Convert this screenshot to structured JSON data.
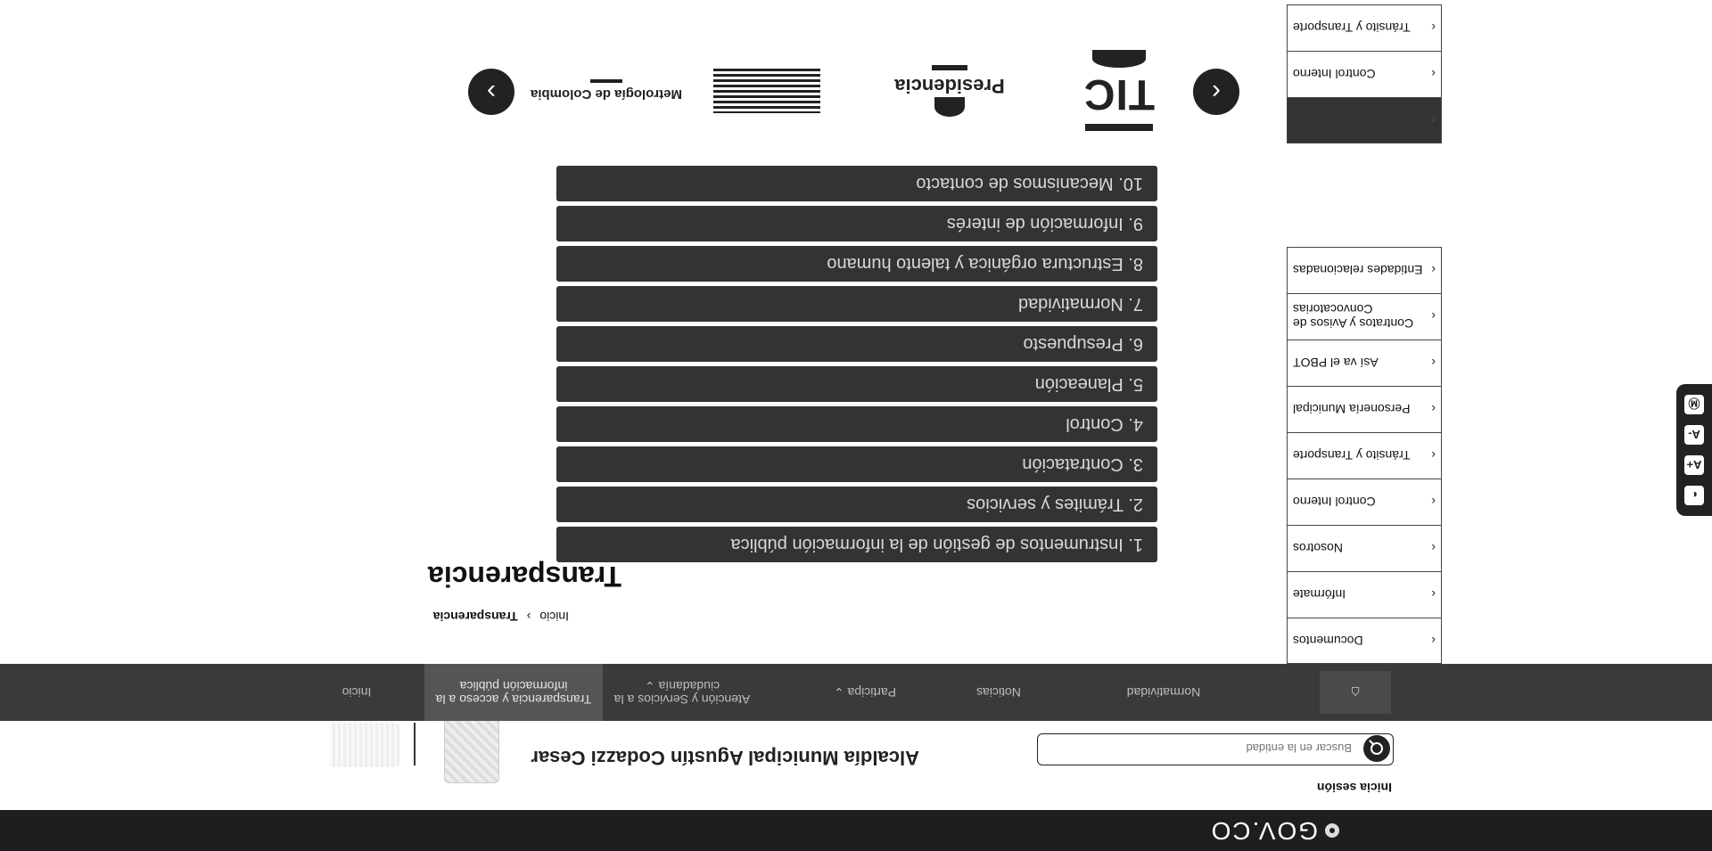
{
  "topbar": {
    "brand": "GOV.CO"
  },
  "header": {
    "login_label": "Inicia sesión",
    "search_placeholder": "Buscar en la entidad",
    "entity_name": "Alcaldía Municipal Agustín Codazzi Cesar"
  },
  "nav": {
    "items": [
      {
        "label": "Normatividad"
      },
      {
        "label": "Noticias"
      },
      {
        "label": "Participa ⌄"
      },
      {
        "label": "Atención y Servicios a la ciudadanía ⌄"
      },
      {
        "label": "Transparencia y acceso a la información pública"
      },
      {
        "label": "Inicio"
      }
    ]
  },
  "breadcrumb": {
    "home": "Inicio",
    "sep": "›",
    "current": "Transparencia"
  },
  "page": {
    "title": "Transparencia"
  },
  "accordion": [
    "1. Instrumentos de gestión de la información pública",
    "2. Trámites y servicios",
    "3. Contratación",
    "4. Control",
    "5. Planeación",
    "6. Presupuesto",
    "7. Normatividad",
    "8. Estructura orgánica y talento humano",
    "9. Información de interés",
    "10. Mecanismos de contacto"
  ],
  "sidebar": [
    "Documentos",
    "Infórmate",
    "Nosotros",
    "Control Interno",
    "Tránsito y Transporte",
    "Personería Municipal",
    "Así va el PBOT",
    "Contratos y Avisos de Convocatorias",
    "Entidades relacionadas"
  ],
  "sidebar2": [
    "",
    "Control Interno",
    "Tránsito y Transporte"
  ],
  "partners": {
    "tic": "TIC",
    "presidencia": "Presidencia",
    "metrologia": "Metrología de Colombia",
    "prev": "‹",
    "next": "›"
  },
  "a11y": [
    "◐",
    "A+",
    "A-",
    "Ⓜ"
  ]
}
